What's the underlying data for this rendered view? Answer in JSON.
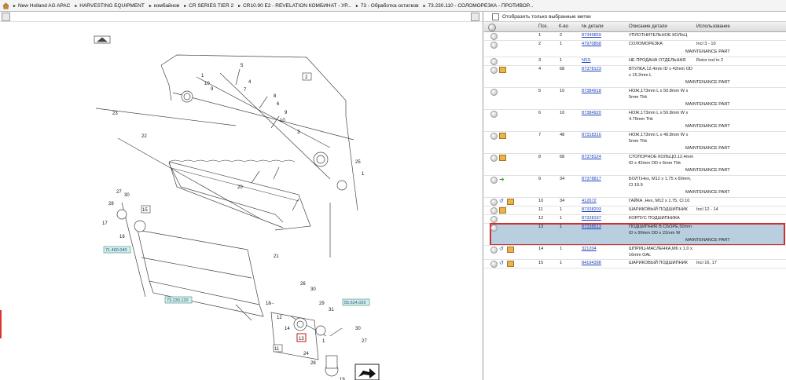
{
  "breadcrumb": [
    "New Holland AG APAC",
    "HARVESTING EQUIPMENT",
    "комбайнов",
    "CR SERIES TIER 2",
    "CR10.90 E2 - REVELATION КОМБИНАТ - УР...",
    "73 - Обработка остатков",
    "73.230.110 - СОЛОМОРЕЗКА - ПРОТИВОР..."
  ],
  "filter_label": "Отобразить только выбранные метки",
  "columns": [
    "Поз.",
    "К-во",
    "№ детали",
    "Описание детали",
    "Использование"
  ],
  "maintenance_label": "MAINTENANCE PART",
  "rows": [
    {
      "pos": "1",
      "qty": "2",
      "part": "87345859",
      "desc": [
        "УПЛОТНИТЕЛЬНОЕ КОЛЬЦ"
      ],
      "usage": "",
      "maint": false,
      "icons": []
    },
    {
      "pos": "2",
      "qty": "1",
      "part": "47970868",
      "desc": [
        "СОЛОМОРЕЗКА"
      ],
      "usage": "Incl 3 - 10",
      "maint": true,
      "icons": []
    },
    {
      "pos": "3",
      "qty": "1",
      "part": "NSS",
      "desc": [
        "НЕ ПРОДАНА ОТДЕЛЬНАЯ"
      ],
      "usage": "Rotor incl in 2",
      "maint": false,
      "icons": []
    },
    {
      "pos": "4",
      "qty": "68",
      "part": "87378123",
      "desc": [
        "ВТУЛКА,12.4mm ID x 42mm OD",
        "x 15.2mm L"
      ],
      "usage": "",
      "maint": true,
      "icons": [
        "box"
      ]
    },
    {
      "pos": "5",
      "qty": "10",
      "part": "87384918",
      "desc": [
        "НОЖ,173mm L x 50.8mm W x",
        "5mm Thk"
      ],
      "usage": "",
      "maint": true,
      "icons": []
    },
    {
      "pos": "6",
      "qty": "10",
      "part": "87384920",
      "desc": [
        "НОЖ,173mm L x 50.8mm W x",
        "4.76mm Thk"
      ],
      "usage": "",
      "maint": true,
      "icons": []
    },
    {
      "pos": "7",
      "qty": "48",
      "part": "87318316",
      "desc": [
        "НОЖ,173mm L x 49.8mm W x",
        "5mm Thk"
      ],
      "usage": "",
      "maint": true,
      "icons": [
        "box"
      ]
    },
    {
      "pos": "8",
      "qty": "68",
      "part": "87378124",
      "desc": [
        "СТОПОРНОЕ КОЛЬЦО,12.4mm",
        "ID x 42mm OD x 6mm Thk"
      ],
      "usage": "",
      "maint": true,
      "icons": [
        "box"
      ]
    },
    {
      "pos": "9",
      "qty": "34",
      "part": "87378817",
      "desc": [
        "БОЛТ,Hex, M12 x 1.75 x 60mm,",
        "Cl 10.9"
      ],
      "usage": "",
      "maint": true,
      "icons": [
        "green"
      ]
    },
    {
      "pos": "10",
      "qty": "34",
      "part": "412672",
      "desc": [
        "ГАЙКА ,Hex, M12 x 1.75, Cl 10"
      ],
      "usage": "",
      "maint": false,
      "icons": [
        "blue",
        "box"
      ]
    },
    {
      "pos": "11",
      "qty": "1",
      "part": "87328203",
      "desc": [
        "ШАРИКОВЫЙ ПОДШИПНИК"
      ],
      "usage": "Incl 12 - 14",
      "maint": false,
      "icons": [
        "box"
      ]
    },
    {
      "pos": "12",
      "qty": "1",
      "part": "87328197",
      "desc": [
        "КОРПУС ПОДШИПНИКА"
      ],
      "usage": "",
      "maint": false,
      "icons": []
    },
    {
      "pos": "13",
      "qty": "1",
      "part": "87338613",
      "desc": [
        "ПОДШИПНИК В СБОРЕ,50mm",
        "ID x 90mm OD x 22mm W"
      ],
      "usage": "",
      "maint": true,
      "icons": [],
      "selected": true
    },
    {
      "pos": "14",
      "qty": "1",
      "part": "321204",
      "desc": [
        "ШПРИЦ-МАСЛЕНКА,M6 x 1.0 x",
        "16mm OAL"
      ],
      "usage": "",
      "maint": false,
      "icons": [
        "blue",
        "box"
      ]
    },
    {
      "pos": "15",
      "qty": "1",
      "part": "84194398",
      "desc": [
        "ШАРИКОВЫЙ ПОДШИПНИК"
      ],
      "usage": "Incl 16, 17",
      "maint": false,
      "icons": [
        "blue",
        "box"
      ]
    }
  ],
  "diagram": {
    "callouts": [
      "1",
      "2",
      "3",
      "4",
      "5",
      "6",
      "7",
      "8",
      "9",
      "10",
      "11",
      "12",
      "13",
      "14",
      "15",
      "16",
      "17",
      "18",
      "19",
      "20",
      "21",
      "22",
      "23",
      "24",
      "25",
      "26",
      "27",
      "28",
      "29",
      "30"
    ],
    "refs": [
      "71.460.040",
      "73.230.120",
      "55.624.020"
    ],
    "highlight": "13"
  }
}
